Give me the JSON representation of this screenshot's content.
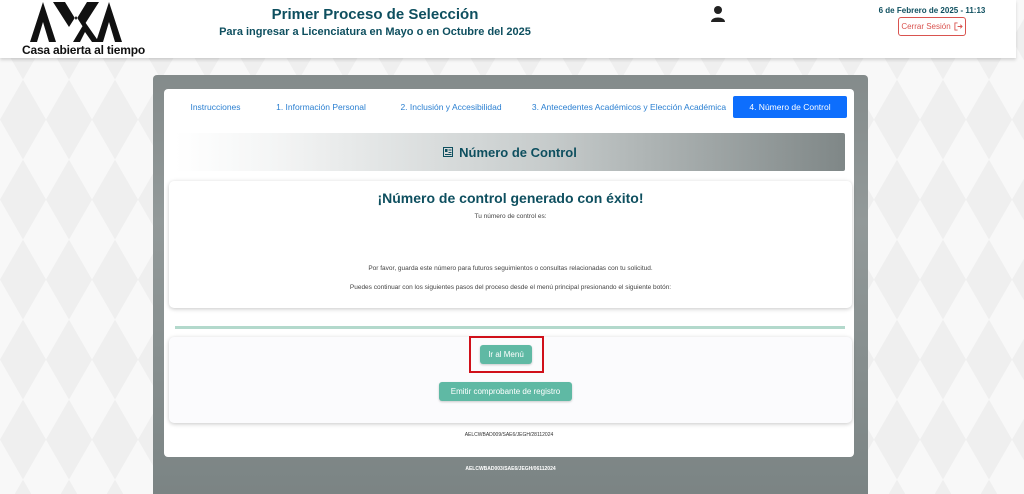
{
  "header": {
    "logo_text": "Casa abierta al tiempo",
    "title": "Primer Proceso de Selección",
    "subtitle": "Para ingresar a Licenciatura en Mayo o en Octubre del 2025",
    "datetime": "6 de Febrero de 2025 - 11:13",
    "logout_label": "Cerrar Sesión",
    "user_icon": "user-icon",
    "logout_icon": "logout-icon"
  },
  "tabs": [
    {
      "label": "Instrucciones",
      "active": false
    },
    {
      "label": "1. Información Personal",
      "active": false
    },
    {
      "label": "2. Inclusión y Accesibilidad",
      "active": false
    },
    {
      "label": "3. Antecedentes Académicos y Elección Académica",
      "active": false
    },
    {
      "label": "4. Número de Control",
      "active": true
    }
  ],
  "section": {
    "title": "Número de Control",
    "icon": "id-card-icon"
  },
  "success": {
    "title": "¡Número de control generado con éxito!",
    "control_label": "Tu número de control es:",
    "save_note": "Por favor, guarda este número para futuros seguimientos o consultas relacionadas con tu solicitud.",
    "continue_note": "Puedes continuar con los siguientes pasos del proceso desde el menú principal presionando el siguiente botón:"
  },
  "actions": {
    "menu_button": "Ir al Menú",
    "receipt_button": "Emitir comprobante de registro"
  },
  "footer": {
    "code_inner": "AELCWBAD009/SAE6/JEGH/28112024",
    "code_outer": "AELCWBAD003/SAE6/JEGH/06112024"
  },
  "colors": {
    "brand": "#0e4f5f",
    "active_tab": "#0d6efd",
    "button": "#5fb9a4",
    "logout": "#d9534f",
    "highlight": "#d0101a"
  }
}
